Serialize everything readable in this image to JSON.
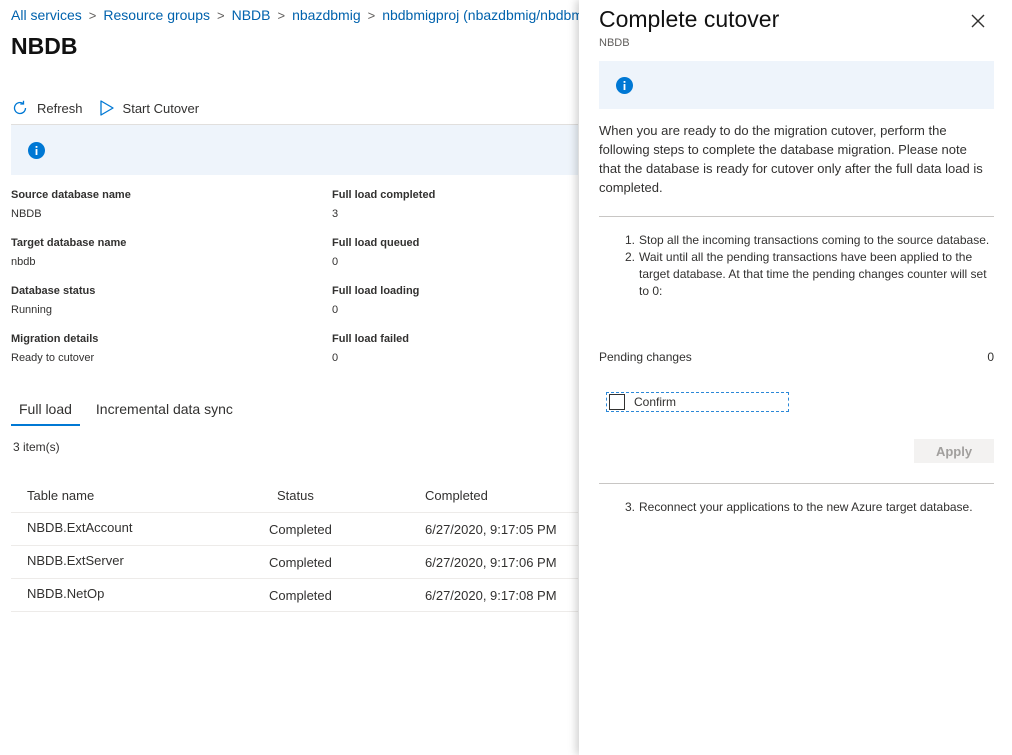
{
  "breadcrumb": [
    "All services",
    "Resource groups",
    "NBDB",
    "nbazdbmig",
    "nbdbmigproj (nbazdbmig/nbdbm"
  ],
  "page_title": "NBDB",
  "toolbar": {
    "refresh_label": "Refresh",
    "start_cutover_label": "Start Cutover"
  },
  "properties": [
    {
      "label": "Source database name",
      "value": "NBDB"
    },
    {
      "label": "Full load completed",
      "value": "3"
    },
    {
      "label": "Target database name",
      "value": "nbdb"
    },
    {
      "label": "Full load queued",
      "value": "0"
    },
    {
      "label": "Database status",
      "value": "Running"
    },
    {
      "label": "Full load loading",
      "value": "0"
    },
    {
      "label": "Migration details",
      "value": "Ready to cutover"
    },
    {
      "label": "Full load failed",
      "value": "0"
    }
  ],
  "tabs": [
    {
      "label": "Full load",
      "active": true
    },
    {
      "label": "Incremental data sync",
      "active": false
    }
  ],
  "item_count": "3 item(s)",
  "table": {
    "columns": [
      "Table name",
      "Status",
      "Completed"
    ],
    "rows": [
      [
        "NBDB.ExtAccount",
        "Completed",
        "6/27/2020, 9:17:05 PM"
      ],
      [
        "NBDB.ExtServer",
        "Completed",
        "6/27/2020, 9:17:06 PM"
      ],
      [
        "NBDB.NetOp",
        "Completed",
        "6/27/2020, 9:17:08 PM"
      ]
    ]
  },
  "blade": {
    "title": "Complete cutover",
    "subtitle": "NBDB",
    "description": "When you are ready to do the migration cutover, perform the following steps to complete the database migration. Please note that the database is ready for cutover only after the full data load is completed.",
    "steps": [
      {
        "num": "1.",
        "text": "Stop all the incoming transactions coming to the source database."
      },
      {
        "num": "2.",
        "text": "Wait until all the pending transactions have been applied to the target database. At that time the pending changes counter will set to 0:"
      }
    ],
    "pending_label": "Pending changes",
    "pending_value": "0",
    "confirm_label": "Confirm",
    "confirm_checked": false,
    "apply_label": "Apply",
    "step3": {
      "num": "3.",
      "text": "Reconnect your applications to the new Azure target database."
    }
  },
  "colors": {
    "accent": "#0078d4",
    "info_bg": "#eef4fb",
    "link": "#0062ad"
  },
  "icons": {
    "refresh": "refresh-icon",
    "start_cutover": "play-icon",
    "info": "info-icon",
    "close": "close-icon",
    "breadcrumb_separator": "chevron-right-icon"
  }
}
